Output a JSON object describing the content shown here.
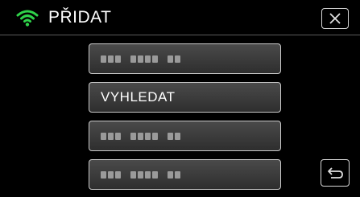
{
  "header": {
    "title": "PŘIDAT",
    "wifi_icon": "wifi-icon",
    "close_icon": "close-icon"
  },
  "list": {
    "items": [
      {
        "label": "",
        "masked": true
      },
      {
        "label": "VYHLEDAT",
        "masked": false
      },
      {
        "label": "",
        "masked": true
      },
      {
        "label": "",
        "masked": true
      }
    ]
  },
  "footer": {
    "back_icon": "return-icon"
  },
  "colors": {
    "wifi": "#2fd24a",
    "background": "#000000",
    "button_border": "#c9c9c9"
  }
}
